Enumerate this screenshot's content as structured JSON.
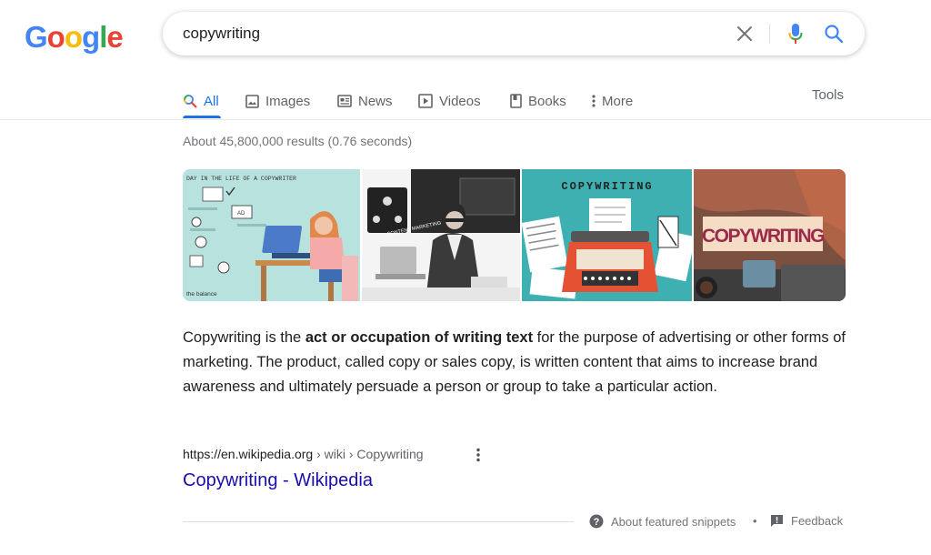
{
  "logo": {
    "text": "Google",
    "letters": [
      "G",
      "o",
      "o",
      "g",
      "l",
      "e"
    ],
    "colors": [
      "#4285f4",
      "#ea4335",
      "#fbbc05",
      "#4285f4",
      "#34a853",
      "#ea4335"
    ]
  },
  "search": {
    "query": "copywriting",
    "icons": {
      "clear": "close-icon",
      "mic": "microphone-icon",
      "search": "search-icon"
    }
  },
  "tabs": [
    {
      "label": "All",
      "icon": "search-icon",
      "active": true
    },
    {
      "label": "Images",
      "icon": "image-icon"
    },
    {
      "label": "News",
      "icon": "newspaper-icon"
    },
    {
      "label": "Videos",
      "icon": "play-icon"
    },
    {
      "label": "Books",
      "icon": "book-icon"
    },
    {
      "label": "More",
      "icon": "more-vert-icon"
    }
  ],
  "tools_label": "Tools",
  "result_stats": "About 45,800,000 results (0.76 seconds)",
  "images": [
    {
      "name": "day-in-the-life",
      "caption": "DAY IN THE LIFE OF A COPYWRITER",
      "small_labels": [
        "AD",
        "the balance"
      ]
    },
    {
      "name": "content-marketing",
      "caption": "CONTENT MARKETING"
    },
    {
      "name": "typewriter",
      "caption": "COPYWRITING"
    },
    {
      "name": "laptop-desk",
      "caption": "COPYWRITING"
    }
  ],
  "snippet": {
    "before": "Copywriting is the ",
    "bold": "act or occupation of writing text",
    "after": " for the purpose of advertising or other forms of marketing. The product, called copy or sales copy, is written content that aims to increase brand awareness and ultimately persuade a person or group to take a particular action."
  },
  "result": {
    "domain": "https://en.wikipedia.org",
    "path": " › wiki › Copywriting",
    "title": "Copywriting - Wikipedia"
  },
  "footer": {
    "about_label": "About featured snippets",
    "separator": "•",
    "feedback_label": "Feedback"
  },
  "colors": {
    "accent": "#1a73e8",
    "link": "#1a0dab",
    "muted": "#70757a"
  }
}
